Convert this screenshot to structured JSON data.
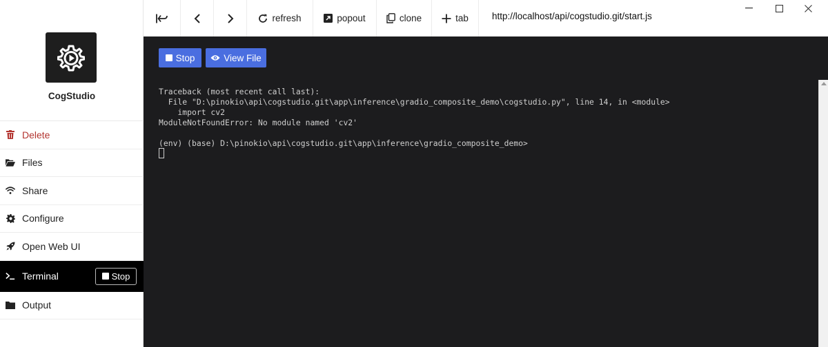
{
  "brand": {
    "name": "CogStudio",
    "logo_icon": "gear-play-icon"
  },
  "nav": {
    "delete": "Delete",
    "files": "Files",
    "share": "Share",
    "configure": "Configure",
    "open_web_ui": "Open Web UI",
    "terminal": "Terminal",
    "terminal_stop": "Stop",
    "output": "Output"
  },
  "toolbar": {
    "refresh": "refresh",
    "popout": "popout",
    "clone": "clone",
    "tab": "tab",
    "url": "http://localhost/api/cogstudio.git/start.js"
  },
  "terminal": {
    "stop_label": "Stop",
    "view_file_label": "View File",
    "output": "Traceback (most recent call last):\n  File \"D:\\pinokio\\api\\cogstudio.git\\app\\inference\\gradio_composite_demo\\cogstudio.py\", line 14, in <module>\n    import cv2\nModuleNotFoundError: No module named 'cv2'\n\n(env) (base) D:\\pinokio\\api\\cogstudio.git\\app\\inference\\gradio_composite_demo>"
  },
  "colors": {
    "accent": "#4a6ee0",
    "delete": "#b3342f",
    "terminal_bg": "#1c1c1e",
    "active_nav_bg": "#000000"
  }
}
